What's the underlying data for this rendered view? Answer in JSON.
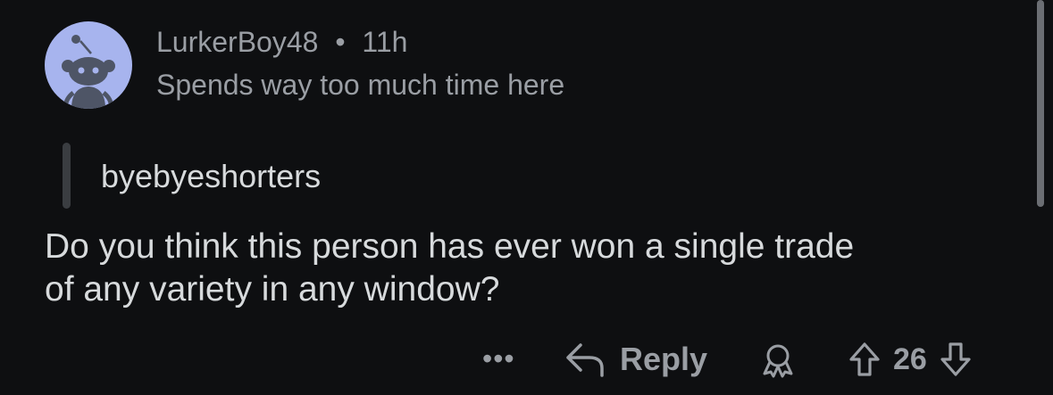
{
  "comment": {
    "author": "LurkerBoy48",
    "separator": "•",
    "age": "11h",
    "flair": "Spends way too much time here",
    "quote": "byebyeshorters",
    "body_lines": [
      "Do you think this person has ever won a single trade",
      "of any variety in any window?"
    ]
  },
  "actions": {
    "more_label": "•••",
    "reply_label": "Reply",
    "score": "26"
  },
  "icons": {
    "avatar": "reddit-snoo-avatar-icon",
    "reply": "reply-arrow-icon",
    "award": "award-icon",
    "upvote": "upvote-arrow-icon",
    "downvote": "downvote-arrow-icon"
  },
  "colors": {
    "background": "#0e0f11",
    "text": "#d7dadc",
    "meta": "#9a9ea4",
    "avatar_bg": "#a7b4ee"
  }
}
